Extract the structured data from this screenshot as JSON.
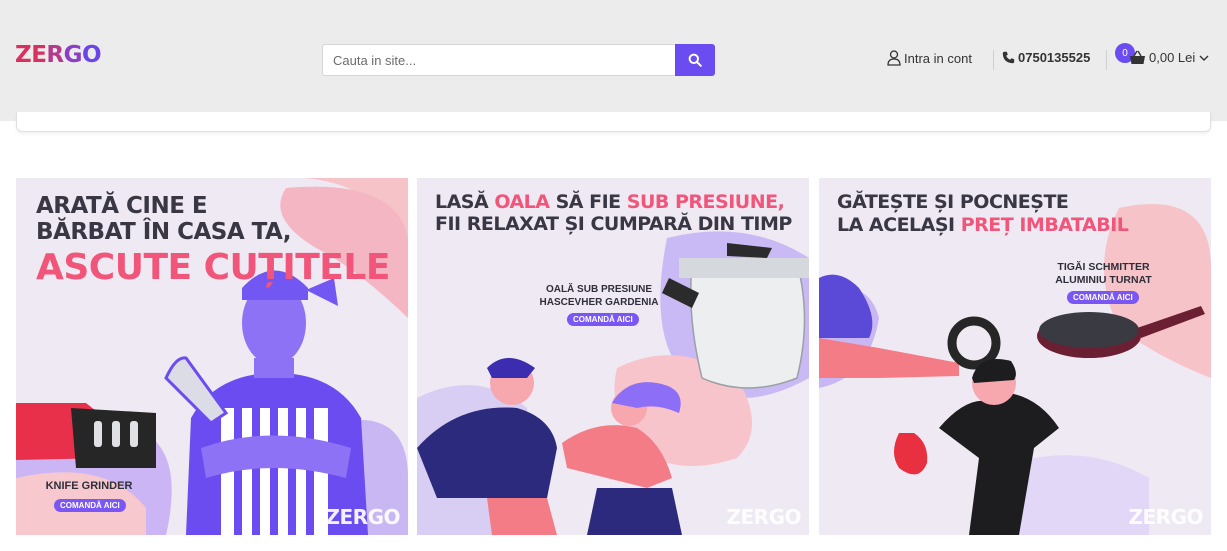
{
  "header": {
    "logo": [
      "Z",
      "E",
      "R",
      "G",
      "O"
    ],
    "search_placeholder": "Cauta in site...",
    "account_label": "Intra in cont",
    "phone": "0750135525",
    "cart_count": "0",
    "cart_total": "0,00 Lei"
  },
  "banners": [
    {
      "headline_line1": "ARATĂ CINE E",
      "headline_line2": "BĂRBAT ÎN CASA TA,",
      "headline_line3": "ASCUTE CUȚITELE",
      "product": "KNIFE GRINDER",
      "cta": "COMANDĂ AICI",
      "watermark": "ZERGO"
    },
    {
      "headline_pre": "LASĂ ",
      "headline_hot1": "OALA",
      "headline_mid": " SĂ FIE ",
      "headline_hot2": "SUB PRESIUNE,",
      "headline_line2": "FII RELAXAT ȘI CUMPARĂ DIN TIMP",
      "product_line1": "OALĂ SUB PRESIUNE",
      "product_line2": "HASCEVHER GARDENIA",
      "cta": "COMANDĂ AICI",
      "watermark": "ZERGO"
    },
    {
      "headline_line1": "GĂTEȘTE ȘI POCNEȘTE",
      "headline_pre2": "LA ACELAȘI ",
      "headline_hot": "PREȚ IMBATABIL",
      "product_line1": "TIGĂI SCHMITTER",
      "product_line2": "ALUMINIU TURNAT",
      "cta": "COMANDĂ AICI",
      "watermark": "ZERGO"
    }
  ],
  "colors": {
    "accent": "#6a4cf0",
    "headline_hot": "#f2557a",
    "header_bg": "#ececec"
  }
}
